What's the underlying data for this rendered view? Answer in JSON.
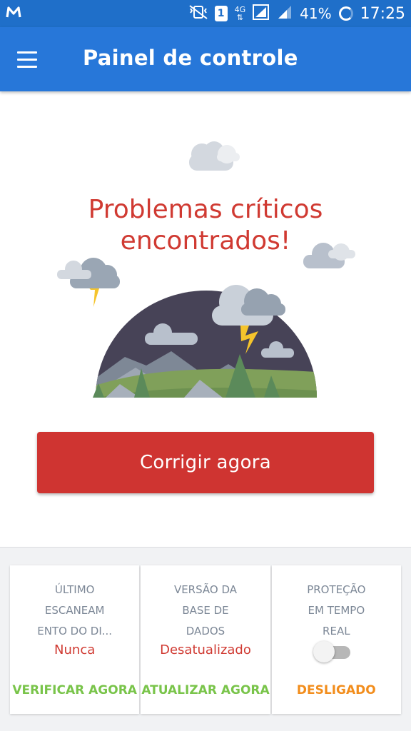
{
  "status_bar": {
    "battery": "41%",
    "time": "17:25",
    "sim_slot": "1",
    "network": "4G"
  },
  "app_bar": {
    "title": "Painel de controle"
  },
  "main": {
    "headline_line1": "Problemas críticos",
    "headline_line2": "encontrados!",
    "fix_button": "Corrigir agora"
  },
  "cards": [
    {
      "label_lines": [
        "ÚLTIMO",
        "ESCANEAM",
        "ENTO DO DI..."
      ],
      "status": "Nunca",
      "action": "VERIFICAR AGORA"
    },
    {
      "label_lines": [
        "VERSÃO DA",
        "BASE DE",
        "DADOS"
      ],
      "status": "Desatualizado",
      "action": "ATUALIZAR AGORA"
    },
    {
      "label_lines": [
        "PROTEÇÃO",
        "EM TEMPO",
        "REAL"
      ],
      "toggle_on": false,
      "action": "DESLIGADO"
    }
  ],
  "colors": {
    "status_bar": "#1f6fc9",
    "app_bar": "#2777d9",
    "critical_red": "#d03a32",
    "action_green": "#79c44a",
    "action_orange": "#f28d1c"
  }
}
